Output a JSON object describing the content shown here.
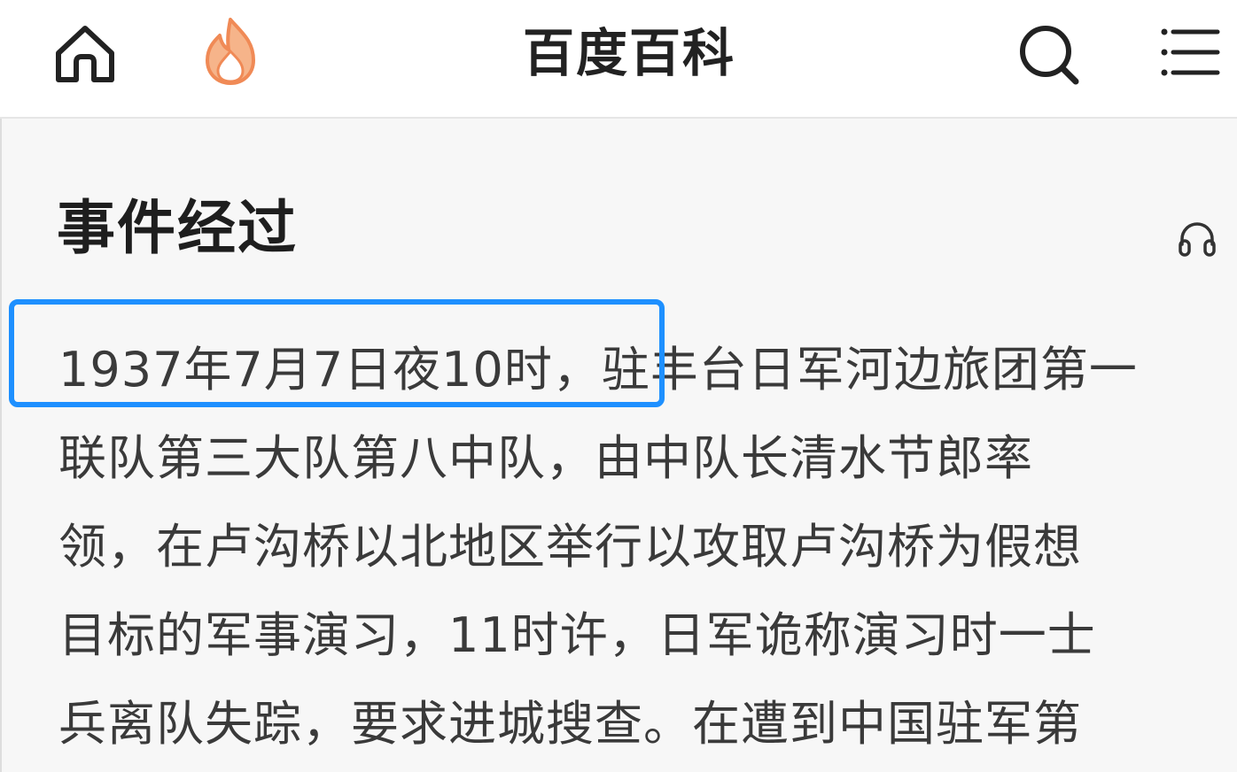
{
  "header": {
    "title": "百度百科",
    "icons": {
      "home": "home-icon",
      "hot": "flame-icon",
      "search": "search-icon",
      "menu": "menu-icon"
    },
    "colors": {
      "flame": "#f0a070",
      "icon": "#222222"
    }
  },
  "article": {
    "section_title": "事件经过",
    "listen_icon": "headphones-icon",
    "lines": [
      "1937年7月7日夜10时，驻丰台日军河边旅团第一",
      "联队第三大队第八中队，由中队长清水节郎率",
      "领，在卢沟桥以北地区举行以攻取卢沟桥为假想",
      "目标的军事演习，11时许，日军诡称演习时一士",
      "兵离队失踪，要求进城搜查。在遭到中国驻军第"
    ],
    "highlight": {
      "text": "1937年7月7日夜10时，驻",
      "color": "#1e90ff"
    }
  }
}
